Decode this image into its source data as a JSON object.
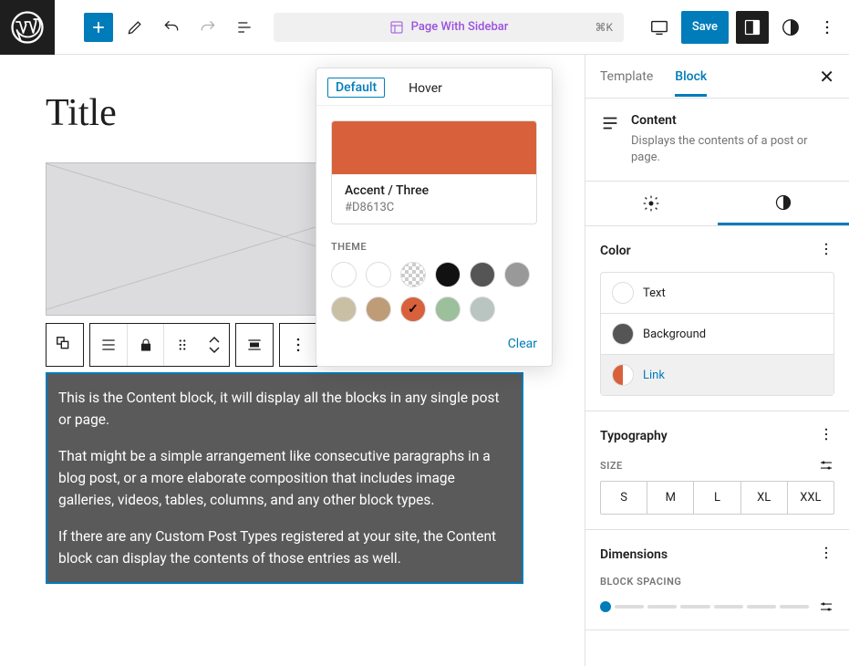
{
  "toolbar": {
    "page_name": "Page With Sidebar",
    "shortcut": "⌘K",
    "save_label": "Save"
  },
  "popover": {
    "tabs": {
      "default": "Default",
      "hover": "Hover"
    },
    "selected_color_name": "Accent / Three",
    "selected_color_hex": "#D8613C",
    "theme_label": "THEME",
    "swatches": [
      {
        "hex": "#FFFFFF"
      },
      {
        "hex": "#FFFFFF"
      },
      {
        "hex": "checker"
      },
      {
        "hex": "#111111"
      },
      {
        "hex": "#555555"
      },
      {
        "hex": "#999999"
      },
      {
        "hex": "#C9BFA5"
      },
      {
        "hex": "#BF9C78"
      },
      {
        "hex": "#D8613C",
        "selected": true
      },
      {
        "hex": "#9CBF9C"
      },
      {
        "hex": "#B8C5C0"
      }
    ],
    "clear_label": "Clear"
  },
  "editor": {
    "page_title": "Title",
    "content_paragraphs": [
      "This is the Content block, it will display all the blocks in any single post or page.",
      "That might be a simple arrangement like consecutive paragraphs in a blog post, or a more elaborate composition that includes image galleries, videos, tables, columns, and any other block types.",
      "If there are any Custom Post Types registered at your site, the Content block can display the contents of those entries as well."
    ]
  },
  "sidebar": {
    "tabs": {
      "template": "Template",
      "block": "Block"
    },
    "block_summary": {
      "title": "Content",
      "description": "Displays the contents of a post or page."
    },
    "color": {
      "title": "Color",
      "options": {
        "text": "Text",
        "background": "Background",
        "link": "Link"
      }
    },
    "typography": {
      "title": "Typography",
      "size_label": "SIZE",
      "sizes": [
        "S",
        "M",
        "L",
        "XL",
        "XXL"
      ]
    },
    "dimensions": {
      "title": "Dimensions",
      "spacing_label": "BLOCK SPACING"
    }
  }
}
